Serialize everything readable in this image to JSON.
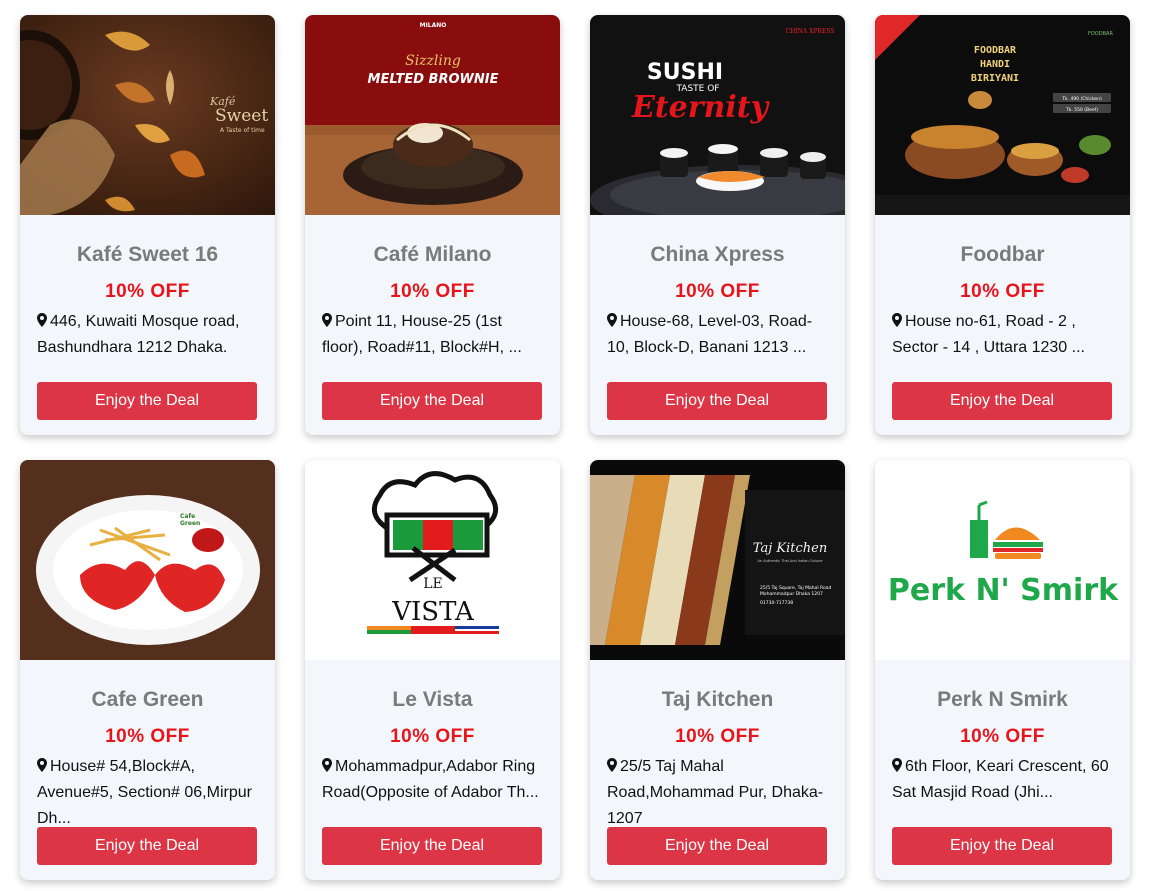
{
  "colors": {
    "card_bg": "#f3f6fa",
    "title": "#7a7a7a",
    "discount": "#e8141b",
    "button": "#dc3545",
    "button_text": "#ffffff"
  },
  "cards": [
    {
      "name": "Kafé Sweet 16",
      "discount": "10% OFF",
      "address": "446, Kuwaiti Mosque road, Bashundhara 1212 Dhaka.",
      "button": "Enjoy the Deal",
      "logo_text": "Sweet 16",
      "logo_sub": "A Taste of time"
    },
    {
      "name": "Café Milano",
      "discount": "10% OFF",
      "address": "Point 11, House-25 (1st floor), Road#11, Block#H, ...",
      "button": "Enjoy the Deal",
      "banner_top": "MILANO",
      "banner_1": "Sizzling",
      "banner_2": "MELTED BROWNIE"
    },
    {
      "name": "China Xpress",
      "discount": "10% OFF",
      "address": "House-68, Level-03, Road-10, Block-D, Banani 1213 ...",
      "button": "Enjoy the Deal",
      "banner_brand": "CHINA XPRESS",
      "banner_1": "SUSHI",
      "banner_2": "TASTE OF",
      "banner_3": "Eternity"
    },
    {
      "name": "Foodbar",
      "discount": "10% OFF",
      "address": "House no-61, Road - 2 , Sector - 14 , Uttara 1230 ...",
      "button": "Enjoy the Deal",
      "banner_1": "FOODBAR",
      "banner_2": "HANDI",
      "banner_3": "BIRIYANI",
      "banner_brand": "FOODBAR",
      "price_1": "Tk. 490 (Chicken)",
      "price_2": "Tk. 550 (Beef)"
    },
    {
      "name": "Cafe Green",
      "discount": "10% OFF",
      "address": "House# 54,Block#A, Avenue#5, Section# 06,Mirpur Dh...",
      "button": "Enjoy the Deal",
      "plate_text_1": "Cafe",
      "plate_text_2": "Green"
    },
    {
      "name": "Le Vista",
      "discount": "10% OFF",
      "address": "Mohammadpur,Adabor Ring Road(Opposite of Adabor Th...",
      "button": "Enjoy the Deal",
      "logo_1": "LE",
      "logo_2": "VISTA"
    },
    {
      "name": "Taj Kitchen",
      "discount": "10% OFF",
      "address": "25/5 Taj Mahal Road,Mohammad Pur, Dhaka-1207",
      "button": "Enjoy the Deal",
      "logo_text": "Taj Kitchen",
      "logo_sub": "An Authentic Thai And Indian Cuisine",
      "addr_1": "25/5 Taj Square, Taj Mahal Road",
      "addr_2": "Mohammadpur Dhaka 1207",
      "phone": "01730-717738"
    },
    {
      "name": "Perk N Smirk",
      "discount": "10% OFF",
      "address": "6th Floor, Keari Crescent, 60 Sat Masjid Road (Jhi...",
      "button": "Enjoy the Deal",
      "logo_text": "Perk N' Smirk"
    }
  ]
}
